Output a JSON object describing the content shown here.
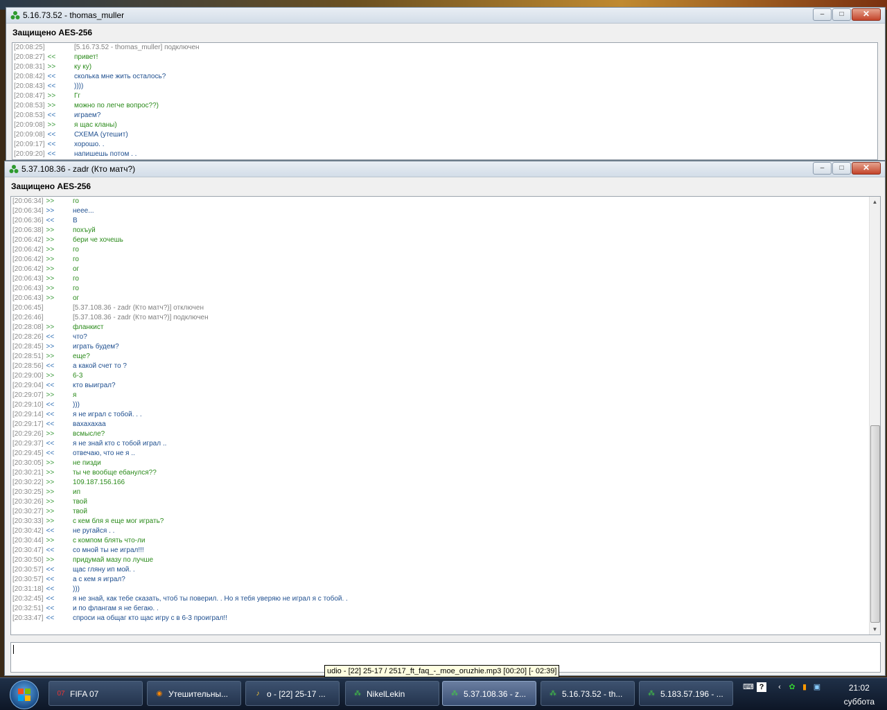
{
  "window1": {
    "title": "5.16.73.52 - thomas_muller",
    "secure_label": "Защищено AES-256",
    "messages": [
      {
        "time": "[20:08:25]",
        "dir": "",
        "text": "[5.16.73.52 - thomas_muller] подключен",
        "kind": "sys"
      },
      {
        "time": "[20:08:27]",
        "dir": "<<",
        "text": "привет!",
        "kind": "out"
      },
      {
        "time": "[20:08:31]",
        "dir": ">>",
        "text": "ку ку)",
        "kind": "out"
      },
      {
        "time": "[20:08:42]",
        "dir": "<<",
        "text": "сколька мне жить осталось?",
        "kind": "in"
      },
      {
        "time": "[20:08:43]",
        "dir": "<<",
        "text": "))))",
        "kind": "in"
      },
      {
        "time": "[20:08:47]",
        "dir": ">>",
        "text": "Гг",
        "kind": "out"
      },
      {
        "time": "[20:08:53]",
        "dir": ">>",
        "text": "можно по легче вопрос??)",
        "kind": "out"
      },
      {
        "time": "[20:08:53]",
        "dir": "<<",
        "text": "играем?",
        "kind": "in"
      },
      {
        "time": "[20:09:08]",
        "dir": ">>",
        "text": "я щас кланы)",
        "kind": "out"
      },
      {
        "time": "[20:09:08]",
        "dir": "<<",
        "text": "СХЕМА (утешит)",
        "kind": "in"
      },
      {
        "time": "[20:09:17]",
        "dir": "<<",
        "text": "хорошо. .",
        "kind": "in"
      },
      {
        "time": "[20:09:20]",
        "dir": "<<",
        "text": "напишешь потом . .",
        "kind": "in"
      }
    ]
  },
  "window2": {
    "title": "5.37.108.36 - zadr (Кто матч?)",
    "secure_label": "Защищено AES-256",
    "messages": [
      {
        "time": "[20:06:34]",
        "dir": ">>",
        "text": "го",
        "kind": "out"
      },
      {
        "time": "[20:06:34]",
        "dir": ">>",
        "text": "неее...",
        "kind": "in"
      },
      {
        "time": "[20:06:36]",
        "dir": "<<",
        "text": "В",
        "kind": "in"
      },
      {
        "time": "[20:06:38]",
        "dir": ">>",
        "text": "похъуй",
        "kind": "out"
      },
      {
        "time": "[20:06:42]",
        "dir": ">>",
        "text": "бери че хочешь",
        "kind": "out"
      },
      {
        "time": "[20:06:42]",
        "dir": ">>",
        "text": "го",
        "kind": "out"
      },
      {
        "time": "[20:06:42]",
        "dir": ">>",
        "text": "го",
        "kind": "out"
      },
      {
        "time": "[20:06:42]",
        "dir": ">>",
        "text": "ог",
        "kind": "out"
      },
      {
        "time": "[20:06:43]",
        "dir": ">>",
        "text": "го",
        "kind": "out"
      },
      {
        "time": "[20:06:43]",
        "dir": ">>",
        "text": "го",
        "kind": "out"
      },
      {
        "time": "[20:06:43]",
        "dir": ">>",
        "text": "ог",
        "kind": "out"
      },
      {
        "time": "[20:06:45]",
        "dir": "",
        "text": "[5.37.108.36 - zadr (Кто матч?)] отключен",
        "kind": "sys"
      },
      {
        "time": "[20:26:46]",
        "dir": "",
        "text": "[5.37.108.36 - zadr (Кто матч?)] подключен",
        "kind": "sys"
      },
      {
        "time": "[20:28:08]",
        "dir": ">>",
        "text": "фланкист",
        "kind": "out"
      },
      {
        "time": "[20:28:26]",
        "dir": "<<",
        "text": "что?",
        "kind": "in"
      },
      {
        "time": "[20:28:45]",
        "dir": ">>",
        "text": "играть будем?",
        "kind": "in"
      },
      {
        "time": "[20:28:51]",
        "dir": ">>",
        "text": "еще?",
        "kind": "out"
      },
      {
        "time": "[20:28:56]",
        "dir": "<<",
        "text": "а какой счет то ?",
        "kind": "in"
      },
      {
        "time": "[20:29:00]",
        "dir": ">>",
        "text": "6-3",
        "kind": "out"
      },
      {
        "time": "[20:29:04]",
        "dir": "<<",
        "text": "кто выиграл?",
        "kind": "in"
      },
      {
        "time": "[20:29:07]",
        "dir": ">>",
        "text": "я",
        "kind": "out"
      },
      {
        "time": "[20:29:10]",
        "dir": "<<",
        "text": ")))",
        "kind": "in"
      },
      {
        "time": "[20:29:14]",
        "dir": "<<",
        "text": "я не играл с тобой. . .",
        "kind": "in"
      },
      {
        "time": "[20:29:17]",
        "dir": "<<",
        "text": "вахахахаа",
        "kind": "in"
      },
      {
        "time": "[20:29:26]",
        "dir": ">>",
        "text": "всмысле?",
        "kind": "out"
      },
      {
        "time": "[20:29:37]",
        "dir": "<<",
        "text": "я не знай кто с тобой играл ..",
        "kind": "in"
      },
      {
        "time": "[20:29:45]",
        "dir": "<<",
        "text": "отвечаю, что не я ..",
        "kind": "in"
      },
      {
        "time": "[20:30:05]",
        "dir": ">>",
        "text": "не пизди",
        "kind": "out"
      },
      {
        "time": "[20:30:21]",
        "dir": ">>",
        "text": "ты че вообще ебанулся??",
        "kind": "out"
      },
      {
        "time": "[20:30:22]",
        "dir": ">>",
        "text": "109.187.156.166",
        "kind": "out"
      },
      {
        "time": "[20:30:25]",
        "dir": ">>",
        "text": "ип",
        "kind": "out"
      },
      {
        "time": "[20:30:26]",
        "dir": ">>",
        "text": "твой",
        "kind": "out"
      },
      {
        "time": "[20:30:27]",
        "dir": ">>",
        "text": "твой",
        "kind": "out"
      },
      {
        "time": "[20:30:33]",
        "dir": ">>",
        "text": "с кем бля я еще мог играть?",
        "kind": "out"
      },
      {
        "time": "[20:30:42]",
        "dir": "<<",
        "text": "не ругайся . .",
        "kind": "in"
      },
      {
        "time": "[20:30:44]",
        "dir": ">>",
        "text": "с компом блять что-ли",
        "kind": "out"
      },
      {
        "time": "[20:30:47]",
        "dir": "<<",
        "text": "со мной ты не играл!!!",
        "kind": "in"
      },
      {
        "time": "[20:30:50]",
        "dir": ">>",
        "text": "придумай мазу по лучше",
        "kind": "out"
      },
      {
        "time": "[20:30:57]",
        "dir": "<<",
        "text": "щас гляну ип мой. .",
        "kind": "in"
      },
      {
        "time": "[20:30:57]",
        "dir": "<<",
        "text": "а с кем я играл?",
        "kind": "in"
      },
      {
        "time": "[20:31:18]",
        "dir": "<<",
        "text": ")))",
        "kind": "in"
      },
      {
        "time": "[20:32:45]",
        "dir": "<<",
        "text": "я не знай, как тебе сказать, чтоб ты поверил. . Но я тебя уверяю не играл я с тобой. .",
        "kind": "in"
      },
      {
        "time": "[20:32:51]",
        "dir": "<<",
        "text": "и по флангам я не бегаю. .",
        "kind": "in"
      },
      {
        "time": "[20:33:47]",
        "dir": "<<",
        "text": "спроси на общаг кто щас игру с в 6-3 проиграл!!",
        "kind": "in"
      }
    ],
    "input_value": ""
  },
  "tooltip": "udio - [22] 25-17 / 2517_ft_faq_-_moe_oruzhie.mp3 [00:20] [- 02:39]",
  "taskbar": {
    "items": [
      {
        "label": "FIFA 07",
        "icon": "fifa-icon"
      },
      {
        "label": "Утешительны...",
        "icon": "firefox-icon"
      },
      {
        "label": "o - [22] 25-17 ...",
        "icon": "aimp-icon"
      },
      {
        "label": "NikelLekin",
        "icon": "chat-icon"
      },
      {
        "label": "5.37.108.36 - z...",
        "icon": "chat-icon",
        "active": true
      },
      {
        "label": "5.16.73.52 - th...",
        "icon": "chat-icon"
      },
      {
        "label": "5.183.57.196 - ...",
        "icon": "chat-icon"
      }
    ],
    "clock_time": "21:02",
    "clock_day": "суббота"
  },
  "colors": {
    "in_text": "#1f4f8f",
    "out_text": "#2a8a1a",
    "system_text": "#808080",
    "timestamp": "#8a8a8a"
  }
}
